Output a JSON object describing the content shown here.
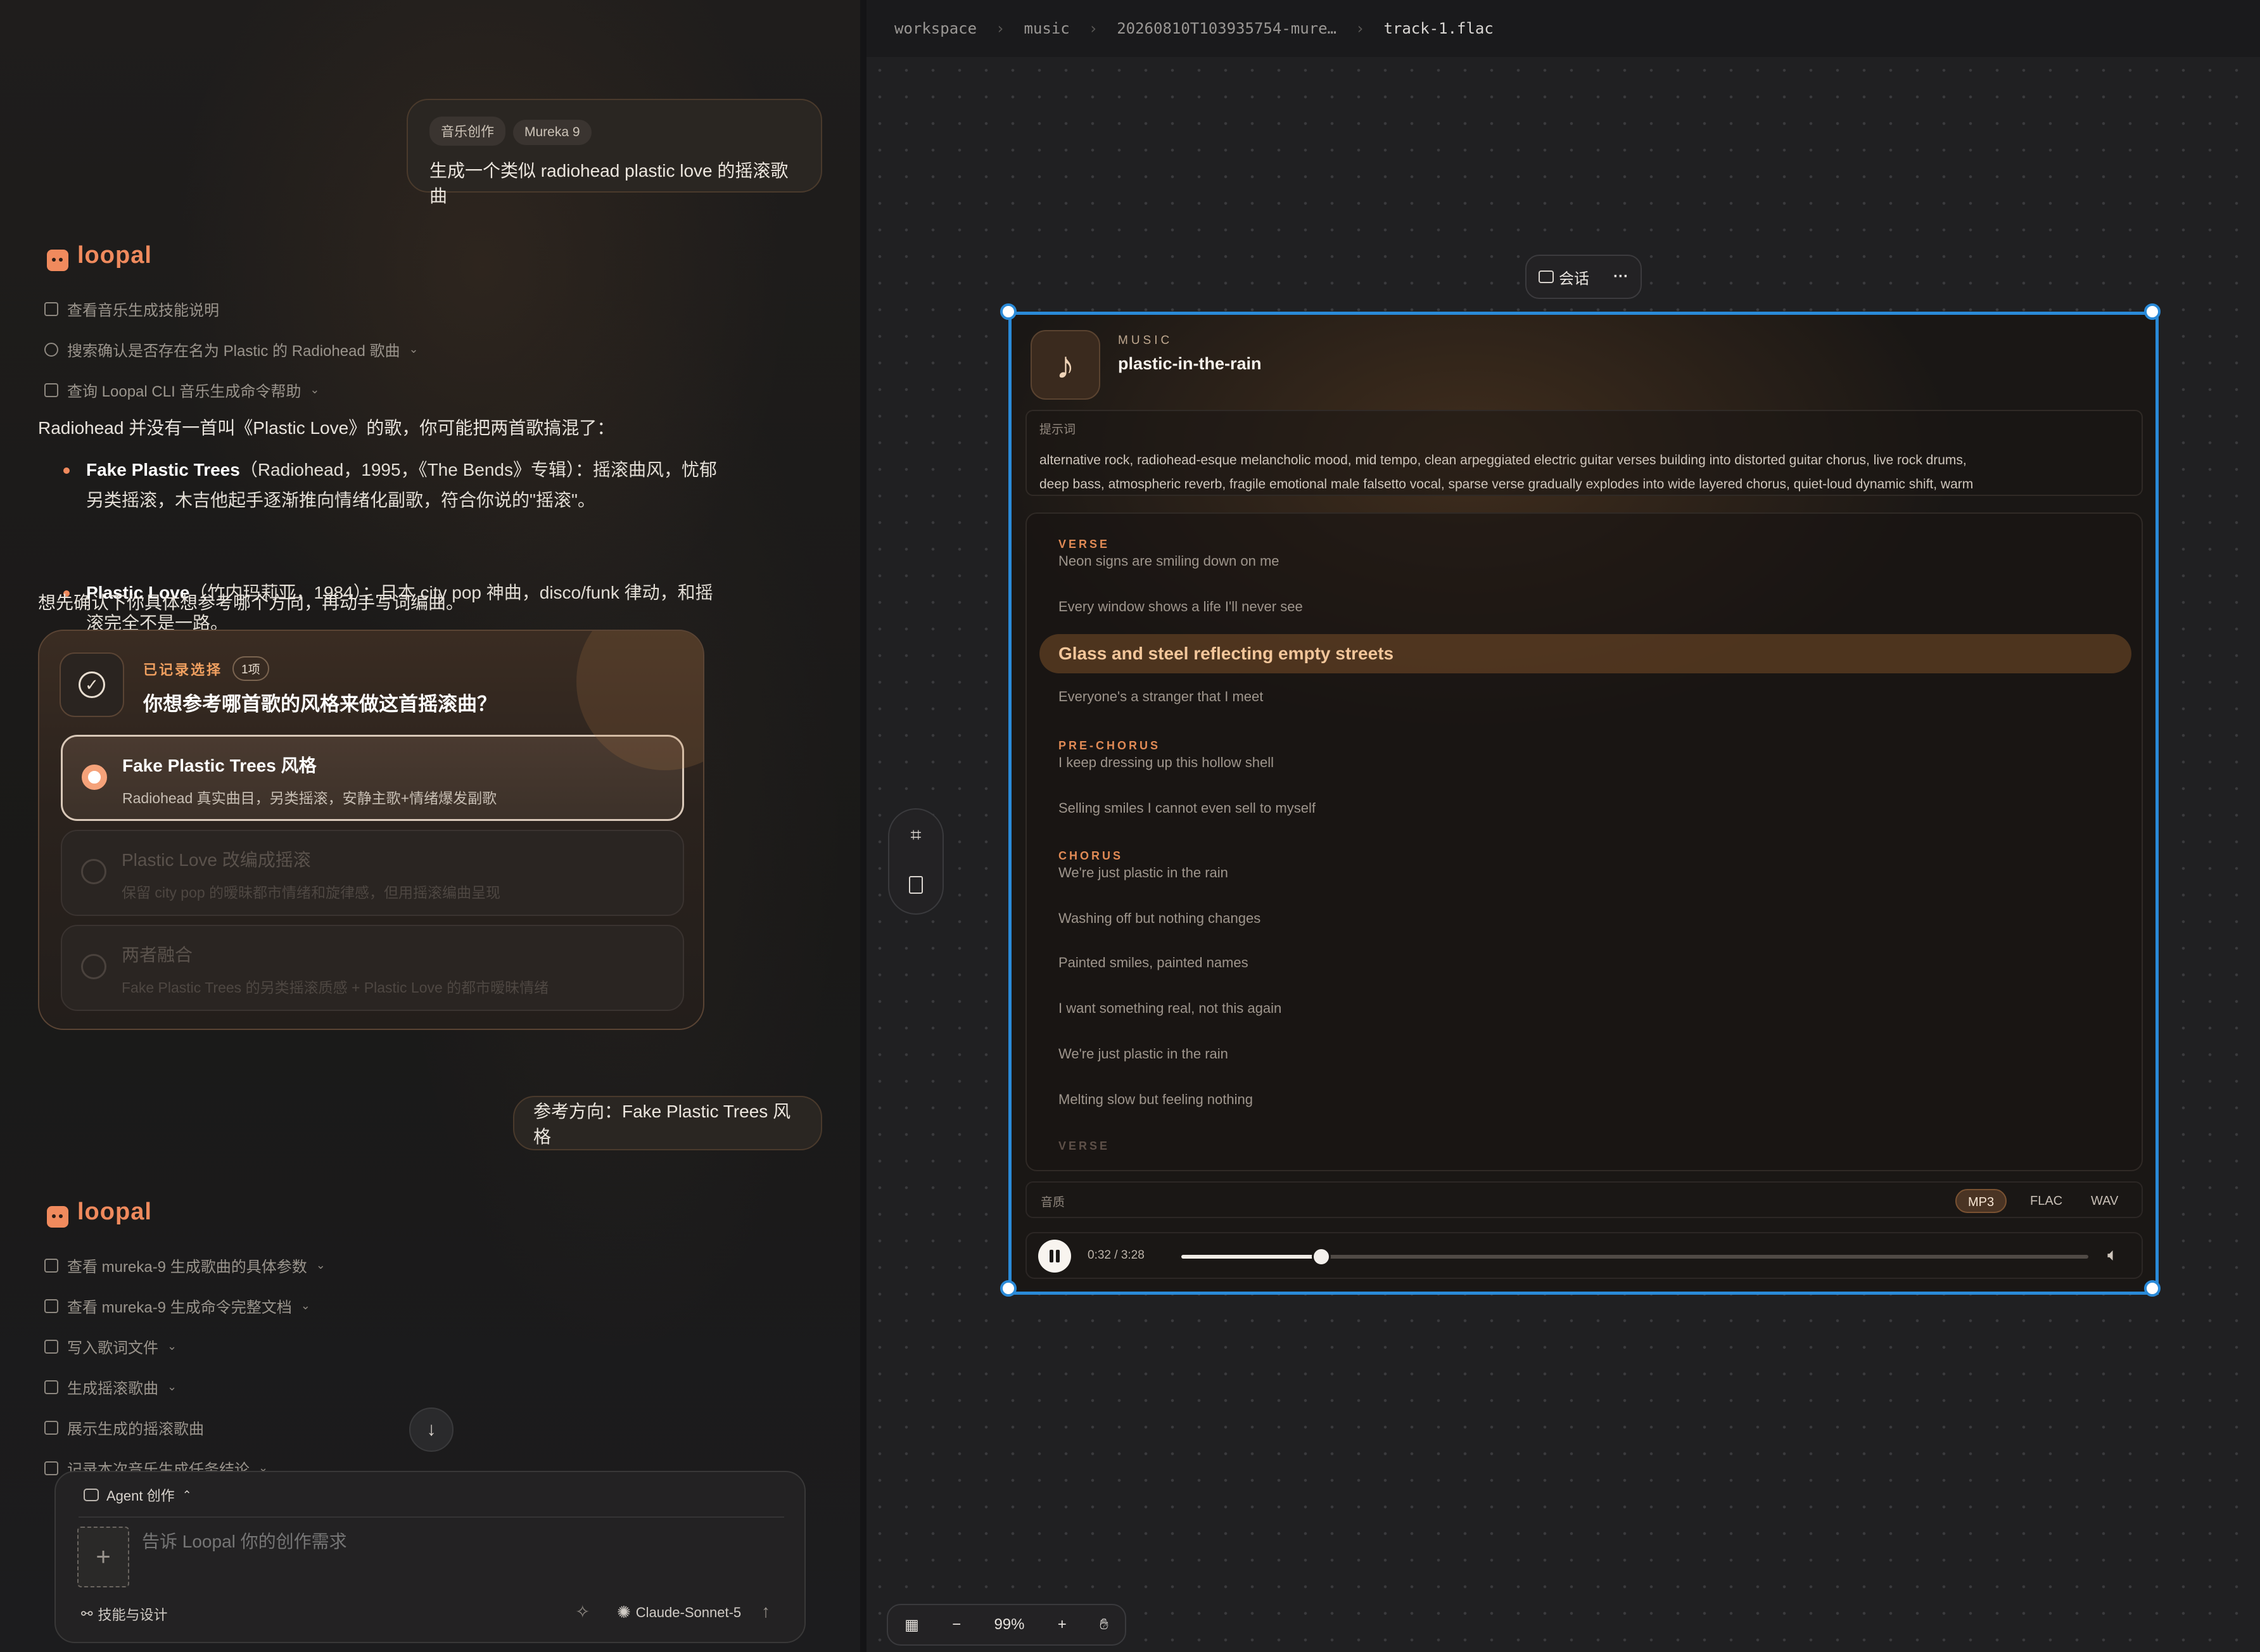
{
  "chat": {
    "user_msg_1": {
      "chips": [
        "音乐创作",
        "Mureka 9"
      ],
      "text": "生成一个类似 radiohead plastic love 的摇滚歌曲"
    },
    "brand": "loopal",
    "steps_1": [
      {
        "text": "查看音乐生成技能说明",
        "icon": "book-icon",
        "expandable": false
      },
      {
        "text": "搜索确认是否存在名为 Plastic 的 Radiohead 歌曲",
        "icon": "search-icon",
        "expandable": true
      },
      {
        "text": "查询 Loopal CLI 音乐生成命令帮助",
        "icon": "terminal-icon",
        "expandable": true
      }
    ],
    "answer_intro": "Radiohead 并没有一首叫《Plastic Love》的歌，你可能把两首歌搞混了：",
    "bullets": [
      {
        "bold": "Fake Plastic Trees",
        "line1": "（Radiohead，1995，《The Bends》专辑）：摇滚曲风，忧郁",
        "line2": "另类摇滚，木吉他起手逐渐推向情绪化副歌，符合你说的\"摇滚\"。"
      },
      {
        "bold": "Plastic Love",
        "line1": "（竹内玛莉亚，1984）：日本 city pop 神曲，disco/funk 律动，和摇",
        "line2": "滚完全不是一路。"
      }
    ],
    "answer_outro": "想先确认下你具体想参考哪个方向，再动手写词编曲。",
    "choice_card": {
      "status": "已记录选择",
      "count": "1项",
      "question": "你想参考哪首歌的风格来做这首摇滚曲？",
      "options": [
        {
          "title": "Fake Plastic Trees 风格",
          "desc": "Radiohead 真实曲目，另类摇滚，安静主歌+情绪爆发副歌",
          "selected": true
        },
        {
          "title": "Plastic Love 改编成摇滚",
          "desc": "保留 city pop 的暧昧都市情绪和旋律感，但用摇滚编曲呈现",
          "selected": false
        },
        {
          "title": "两者融合",
          "desc": "Fake Plastic Trees 的另类摇滚质感 + Plastic Love 的都市暧昧情绪",
          "selected": false
        }
      ]
    },
    "user_msg_2": "参考方向：Fake Plastic Trees 风格",
    "steps_2": [
      {
        "text": "查看 mureka-9 生成歌曲的具体参数",
        "icon": "terminal-icon",
        "expandable": true
      },
      {
        "text": "查看 mureka-9 生成命令完整文档",
        "icon": "terminal-icon",
        "expandable": true
      },
      {
        "text": "写入歌词文件",
        "icon": "edit-icon",
        "expandable": true
      },
      {
        "text": "生成摇滚歌曲",
        "icon": "terminal-icon",
        "expandable": true
      },
      {
        "text": "展示生成的摇滚歌曲",
        "icon": "copy-icon",
        "expandable": false
      },
      {
        "text": "记录本次音乐生成任务结论",
        "icon": "calendar-icon",
        "expandable": true
      }
    ],
    "composer": {
      "mode": "Agent 创作",
      "placeholder": "告诉 Loopal 你的创作需求",
      "skills": "技能与设计",
      "model": "Claude-Sonnet-5"
    }
  },
  "breadcrumb": [
    "workspace",
    "music",
    "20260810T103935754-mure…",
    "track-1.flac"
  ],
  "float_bar": {
    "chat_label": "会话",
    "more": "···"
  },
  "player": {
    "kind": "MUSIC",
    "title": "plastic-in-the-rain",
    "prompt_label": "提示词",
    "prompt_line1": "alternative rock, radiohead-esque melancholic mood, mid tempo, clean arpeggiated electric guitar verses building into distorted guitar chorus, live rock drums,",
    "prompt_line2": "deep bass, atmospheric reverb, fragile emotional male falsetto vocal, sparse verse gradually explodes into wide layered chorus, quiet-loud dynamic shift, warm",
    "lyrics": {
      "verse1_label": "VERSE",
      "l1": "Neon signs are smiling down on me",
      "l2": "Every window shows a life I'll never see",
      "l3": "Glass and steel reflecting empty streets",
      "l4": "Everyone's a stranger that I meet",
      "pre_label": "PRE-CHORUS",
      "l5": "I keep dressing up this hollow shell",
      "l6": "Selling smiles I cannot even sell to myself",
      "chorus_label": "CHORUS",
      "l7": "We're just plastic in the rain",
      "l8": "Washing off but nothing changes",
      "l9": "Painted smiles, painted names",
      "l10": "I want something real, not this again",
      "l11": "We're just plastic in the rain",
      "l12": "Melting slow but feeling nothing",
      "verse2_label": "VERSE"
    },
    "quality_label": "音质",
    "formats": [
      "MP3",
      "FLAC",
      "WAV"
    ],
    "selected_format": "MP3",
    "time": "0:32 / 3:28",
    "progress": 0.154
  },
  "zoom": {
    "level": "99%",
    "minus": "−",
    "plus": "+"
  }
}
